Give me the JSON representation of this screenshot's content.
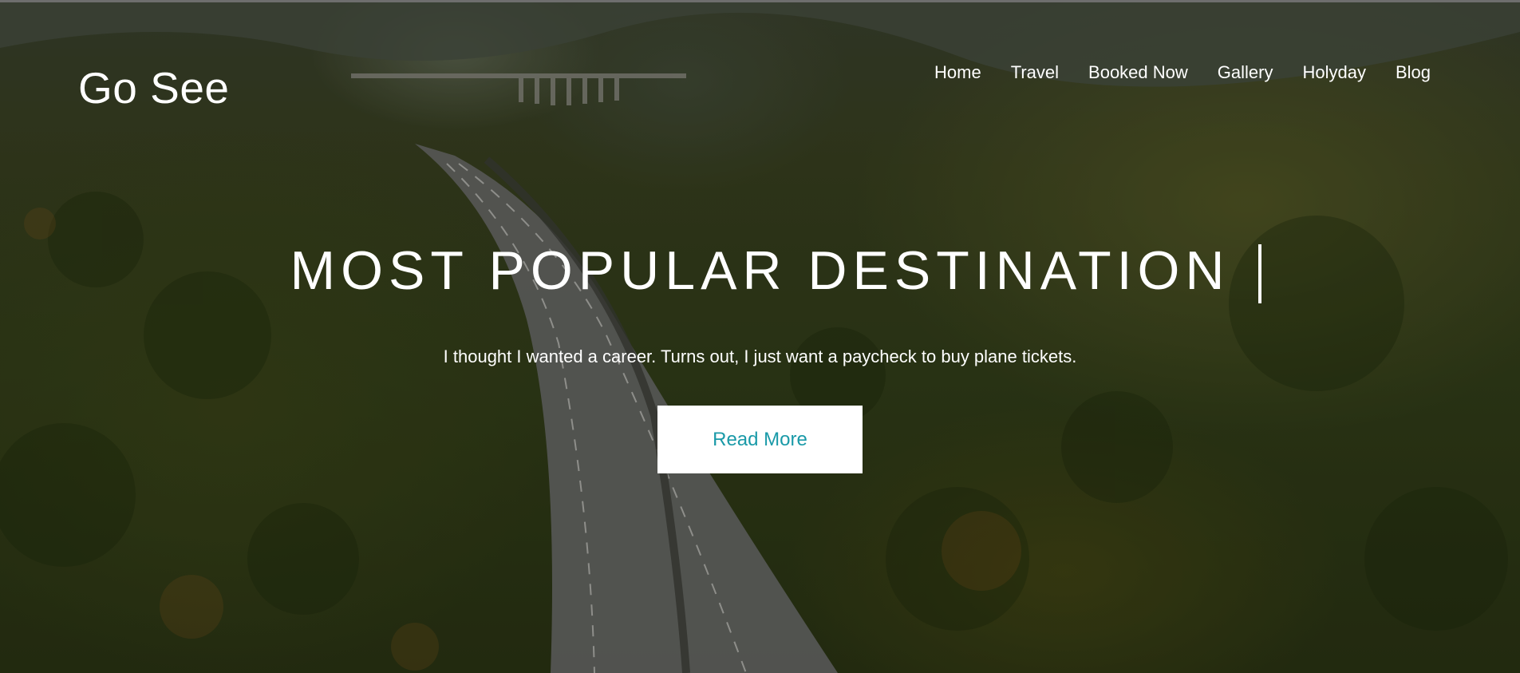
{
  "brand": {
    "logo_text": "Go See"
  },
  "nav": {
    "items": [
      {
        "label": "Home"
      },
      {
        "label": "Travel"
      },
      {
        "label": "Booked Now"
      },
      {
        "label": "Gallery"
      },
      {
        "label": "Holyday"
      },
      {
        "label": "Blog"
      }
    ]
  },
  "hero": {
    "headline": "MOST POPULAR DESTINATION",
    "subtitle": "I thought I wanted a career. Turns out, I just want a paycheck to buy plane tickets.",
    "cta_label": "Read More",
    "background_image": "aerial view of highway winding through forested mountains",
    "colors": {
      "text": "#ffffff",
      "button_bg": "#ffffff",
      "button_text": "#1a9aa8"
    }
  }
}
